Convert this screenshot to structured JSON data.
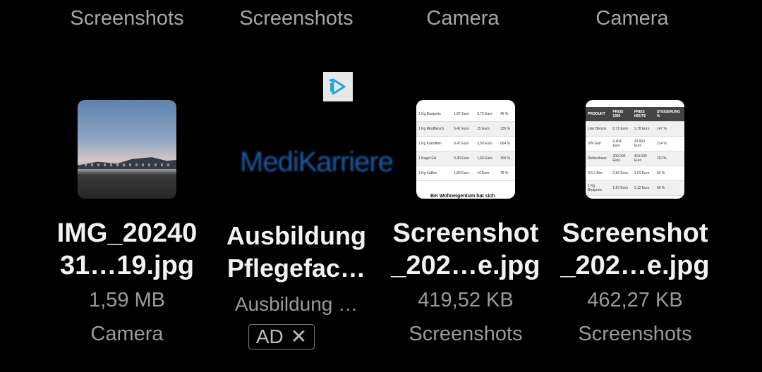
{
  "top_folders": [
    "Screenshots",
    "Screenshots",
    "Camera",
    "Camera"
  ],
  "items": [
    {
      "name_line1": "IMG_20240",
      "name_line2": "31…19.jpg",
      "size": "1,59 MB",
      "folder": "Camera",
      "thumb_icon": "landscape-photo"
    },
    {
      "name_line1": "Ausbildung",
      "name_line2": "Pflegefac…",
      "subtitle": "Ausbildung …",
      "ad_label": "AD",
      "ad_close": "✕",
      "logo_text": "MediKarriere",
      "thumb_icon": "ad-logo"
    },
    {
      "name_line1": "Screenshot",
      "name_line2": "_202…e.jpg",
      "size": "419,52 KB",
      "folder": "Screenshots",
      "thumb_icon": "document-table"
    },
    {
      "name_line1": "Screenshot",
      "name_line2": "_202…e.jpg",
      "size": "462,27 KB",
      "folder": "Screenshots",
      "thumb_icon": "document-table"
    }
  ],
  "doc1": {
    "rows": [
      [
        "1 Kg Brotpreis",
        "1,87 Euro",
        "3,72 Euro",
        "46 %"
      ],
      [
        "1 Kg Rindfleisch",
        "5,41 Euro",
        "15 Euro",
        "135 %"
      ],
      [
        "1 Kg Kartoffeln",
        "0,47 Euro",
        "3,50 Euro",
        "664 %"
      ],
      [
        "1 Kugel Eis",
        "0,40 Euro",
        "1,60 Euro",
        "300 %"
      ],
      [
        "1 Kg Kaffee",
        "1,80 Euro",
        "14 Euro",
        "78 %"
      ]
    ],
    "footer": "Bei Wohneigentum hat sich"
  },
  "doc2": {
    "header": [
      "PRODUKT",
      "PREIS 1980",
      "PREIS HEUTE",
      "STEIGERUNG %"
    ],
    "rows": [
      [
        "Liter Benzin",
        "0,71 Euro",
        "1,78 Euro",
        "147 %"
      ],
      [
        "VW Golf",
        "9.404 Euro",
        "29.960 Euro",
        "214 %"
      ],
      [
        "Reihenhaus",
        "200.000 Euro",
        "419.000 Euro",
        "110 %"
      ],
      [
        "0,5 L Bier",
        "0,56 Euro",
        "1,01 Euro",
        "83 %"
      ],
      [
        "1 Kg Brotpreis",
        "1,87 Euro",
        "3,12 Euro",
        "66 %"
      ]
    ]
  },
  "colors": {
    "background": "#000000",
    "name_text": "#f2f2f2",
    "meta_text": "#9a9a9a",
    "ad_logo": "#1a5da8"
  }
}
